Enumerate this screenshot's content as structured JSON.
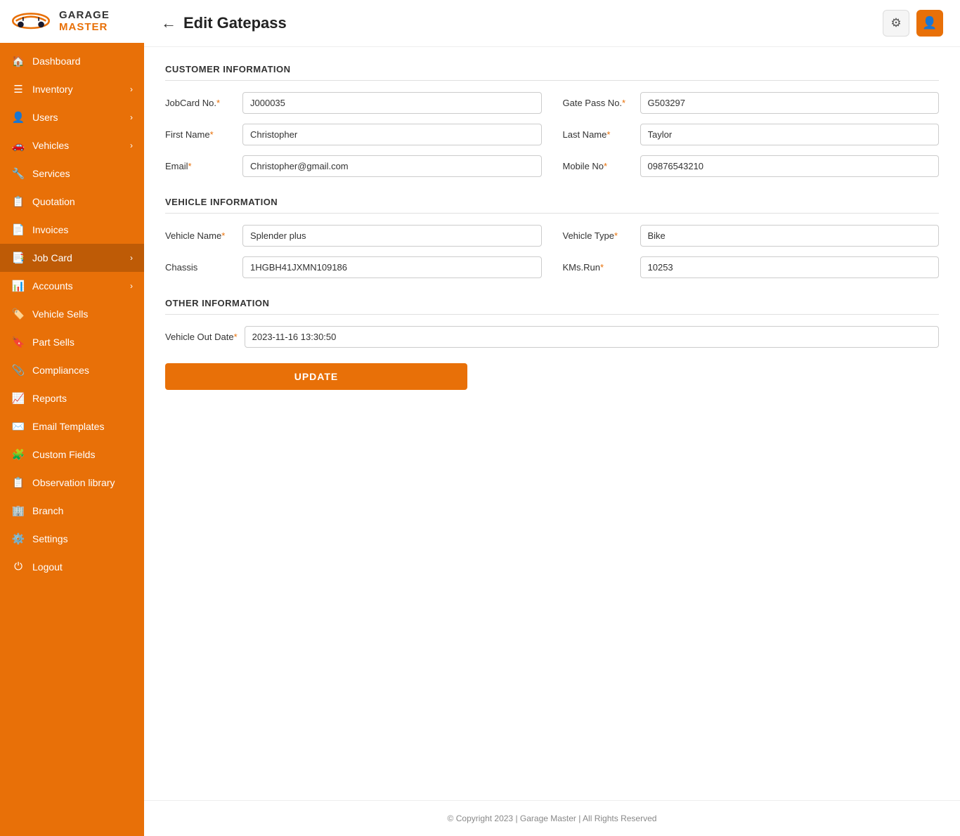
{
  "brand": {
    "garage": "GARAGE",
    "master": "MASTER"
  },
  "sidebar": {
    "items": [
      {
        "id": "dashboard",
        "label": "Dashboard",
        "icon": "🏠",
        "hasChevron": false
      },
      {
        "id": "inventory",
        "label": "Inventory",
        "icon": "☰",
        "hasChevron": true
      },
      {
        "id": "users",
        "label": "Users",
        "icon": "👤",
        "hasChevron": true
      },
      {
        "id": "vehicles",
        "label": "Vehicles",
        "icon": "🚗",
        "hasChevron": true
      },
      {
        "id": "services",
        "label": "Services",
        "icon": "🔧",
        "hasChevron": false
      },
      {
        "id": "quotation",
        "label": "Quotation",
        "icon": "📋",
        "hasChevron": false
      },
      {
        "id": "invoices",
        "label": "Invoices",
        "icon": "📄",
        "hasChevron": false
      },
      {
        "id": "jobcard",
        "label": "Job Card",
        "icon": "📑",
        "hasChevron": true,
        "active": true
      },
      {
        "id": "accounts",
        "label": "Accounts",
        "icon": "📊",
        "hasChevron": true
      },
      {
        "id": "vehicle-sells",
        "label": "Vehicle Sells",
        "icon": "🏷️",
        "hasChevron": false
      },
      {
        "id": "part-sells",
        "label": "Part Sells",
        "icon": "🔖",
        "hasChevron": false
      },
      {
        "id": "compliances",
        "label": "Compliances",
        "icon": "📎",
        "hasChevron": false
      },
      {
        "id": "reports",
        "label": "Reports",
        "icon": "📈",
        "hasChevron": false
      },
      {
        "id": "email-templates",
        "label": "Email Templates",
        "icon": "✉️",
        "hasChevron": false
      },
      {
        "id": "custom-fields",
        "label": "Custom Fields",
        "icon": "🧩",
        "hasChevron": false
      },
      {
        "id": "observation-library",
        "label": "Observation library",
        "icon": "📋",
        "hasChevron": false
      },
      {
        "id": "branch",
        "label": "Branch",
        "icon": "🏢",
        "hasChevron": false
      },
      {
        "id": "settings",
        "label": "Settings",
        "icon": "⚙️",
        "hasChevron": false
      },
      {
        "id": "logout",
        "label": "Logout",
        "icon": "⏻",
        "hasChevron": false
      }
    ]
  },
  "header": {
    "back_label": "←",
    "title": "Edit Gatepass",
    "gear_icon": "⚙",
    "user_icon": "👤"
  },
  "customer_info": {
    "section_title": "CUSTOMER INFORMATION",
    "fields": [
      {
        "label": "JobCard No.",
        "required": true,
        "value": "J000035",
        "id": "jobcard-no"
      },
      {
        "label": "Gate Pass No.",
        "required": true,
        "value": "G503297",
        "id": "gatepass-no"
      },
      {
        "label": "First Name",
        "required": true,
        "value": "Christopher",
        "id": "first-name"
      },
      {
        "label": "Last Name",
        "required": true,
        "value": "Taylor",
        "id": "last-name"
      },
      {
        "label": "Email",
        "required": true,
        "value": "Christopher@gmail.com",
        "id": "email"
      },
      {
        "label": "Mobile No",
        "required": true,
        "value": "09876543210",
        "id": "mobile"
      }
    ]
  },
  "vehicle_info": {
    "section_title": "VEHICLE INFORMATION",
    "fields": [
      {
        "label": "Vehicle Name",
        "required": true,
        "value": "Splender plus",
        "id": "vehicle-name"
      },
      {
        "label": "Vehicle Type",
        "required": true,
        "value": "Bike",
        "id": "vehicle-type"
      },
      {
        "label": "Chassis",
        "required": false,
        "value": "1HGBH41JXMN109186",
        "id": "chassis"
      },
      {
        "label": "KMs.Run",
        "required": true,
        "value": "10253",
        "id": "kms-run"
      }
    ]
  },
  "other_info": {
    "section_title": "OTHER INFORMATION",
    "fields": [
      {
        "label": "Vehicle Out Date",
        "required": true,
        "value": "2023-11-16 13:30:50",
        "id": "vehicle-out-date"
      }
    ]
  },
  "update_btn_label": "UPDATE",
  "footer": {
    "text": "© Copyright 2023 | Garage Master | All Rights Reserved"
  }
}
